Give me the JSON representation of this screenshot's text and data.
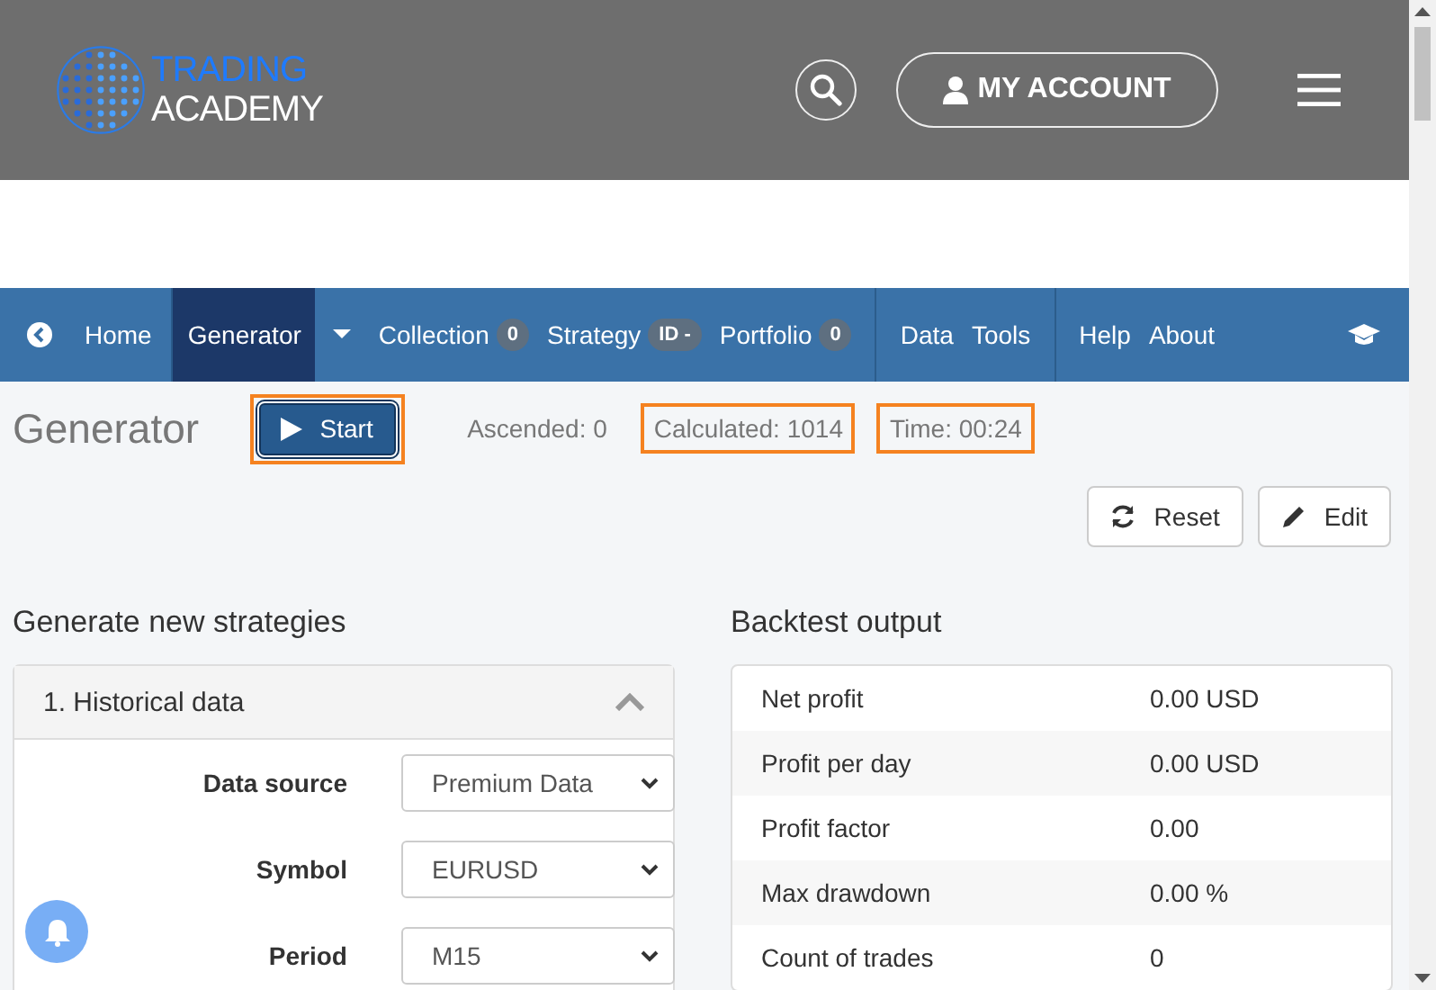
{
  "header": {
    "logo": {
      "line1": "TRADING",
      "line2": "ACADEMY"
    },
    "account_button": "MY ACCOUNT"
  },
  "nav": {
    "items": [
      {
        "label": "Home",
        "kind": "home",
        "selected": false
      },
      {
        "label": "Generator",
        "kind": "dropdown",
        "selected": true
      },
      {
        "label": "Collection",
        "kind": "badge",
        "badge": "0",
        "selected": false
      },
      {
        "label": "Strategy",
        "kind": "badge",
        "badge": "ID -",
        "selected": false
      },
      {
        "label": "Portfolio",
        "kind": "badge",
        "badge": "0",
        "selected": false
      },
      {
        "label": "Data",
        "kind": "group_start",
        "selected": false
      },
      {
        "label": "Tools",
        "kind": "plain",
        "selected": false
      },
      {
        "label": "Help",
        "kind": "group_start",
        "selected": false
      },
      {
        "label": "About",
        "kind": "plain",
        "selected": false
      }
    ]
  },
  "toolbar": {
    "title": "Generator",
    "start_button": {
      "label": "Start",
      "highlighted": true
    },
    "stats": [
      {
        "text": "Ascended: 0",
        "highlighted": false
      },
      {
        "text": "Calculated: 1014",
        "highlighted": true
      },
      {
        "text": "Time: 00:24",
        "highlighted": true
      }
    ],
    "buttons": [
      {
        "label": "Reset",
        "kind": "reset"
      },
      {
        "label": "Edit",
        "kind": "edit"
      }
    ]
  },
  "generate": {
    "title": "Generate new strategies",
    "panel": {
      "title": "1. Historical data",
      "expanded": true,
      "fields": [
        {
          "label": "Data source",
          "value": "Premium Data"
        },
        {
          "label": "Symbol",
          "value": "EURUSD"
        },
        {
          "label": "Period",
          "value": "M15"
        }
      ]
    }
  },
  "backtest": {
    "title": "Backtest output",
    "rows": [
      {
        "label": "Net profit",
        "value": "0.00 USD"
      },
      {
        "label": "Profit per day",
        "value": "0.00 USD"
      },
      {
        "label": "Profit factor",
        "value": "0.00"
      },
      {
        "label": "Max drawdown",
        "value": "0.00 %"
      },
      {
        "label": "Count of trades",
        "value": "0"
      }
    ]
  }
}
